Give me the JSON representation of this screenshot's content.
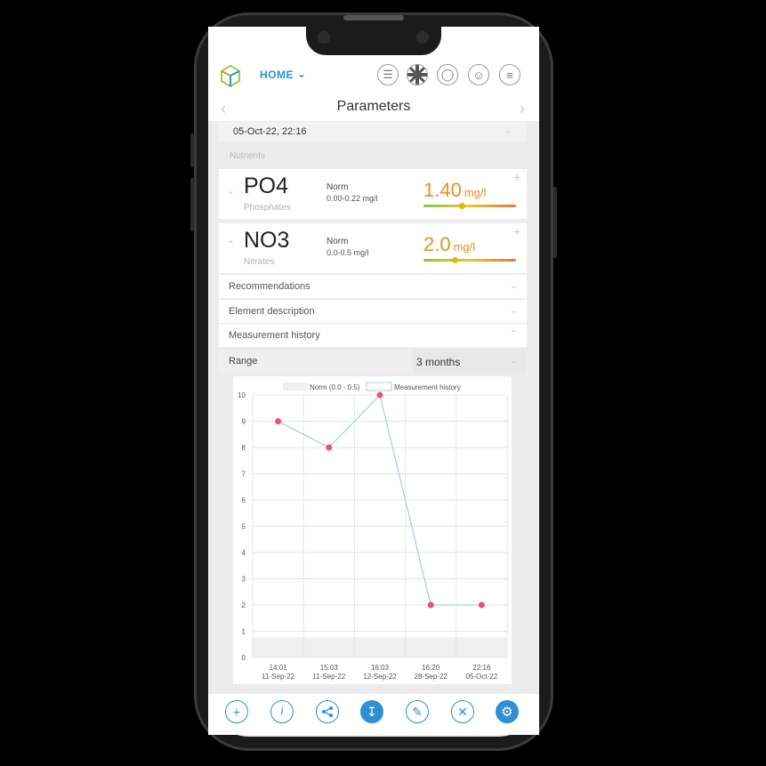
{
  "header": {
    "home_label": "HOME",
    "icons": [
      "chat-icon",
      "language-flag-icon",
      "globe-icon",
      "user-icon",
      "menu-icon"
    ]
  },
  "page": {
    "title": "Parameters",
    "datetime": "05-Oct-22, 22:16",
    "section_label": "Nutrients"
  },
  "parameters": [
    {
      "symbol": "PO4",
      "name": "Phosphates",
      "norm_label": "Norm",
      "norm_range": "0.00-0.22 mg/l",
      "value": "1.40",
      "unit": "mg/l",
      "gauge_level": 0.42
    },
    {
      "symbol": "NO3",
      "name": "Nitrates",
      "norm_label": "Norm",
      "norm_range": "0.0-0.5 mg/l",
      "value": "2.0",
      "unit": "mg/l",
      "gauge_level": 0.34
    }
  ],
  "accordions": {
    "recommendations": "Recommendations",
    "element_description": "Element description",
    "measurement_history": "Measurement history"
  },
  "range": {
    "label": "Range",
    "value": "3 months"
  },
  "chart_data": {
    "type": "line",
    "legend": [
      "Norm (0.0 - 0.5)",
      "Measurement history"
    ],
    "x": [
      "14:01 11-Sep-22",
      "15:03 11-Sep-22",
      "16:03 12-Sep-22",
      "16:20 28-Sep-22",
      "22:16 05-Oct-22"
    ],
    "x_time": [
      "14:01",
      "15:03",
      "16:03",
      "16:20",
      "22:16"
    ],
    "x_date": [
      "11-Sep-22",
      "11-Sep-22",
      "12-Sep-22",
      "28-Sep-22",
      "05-Oct-22"
    ],
    "series": [
      {
        "name": "Measurement history",
        "values": [
          9,
          8,
          10,
          2,
          2
        ]
      }
    ],
    "norm_band": [
      0.0,
      0.5
    ],
    "ylim": [
      0,
      10
    ],
    "yticks": [
      0,
      1,
      2,
      3,
      4,
      5,
      6,
      7,
      8,
      9,
      10
    ],
    "grid": true,
    "legend_position": "top",
    "colors": {
      "line": "#a9cfe8",
      "point": "#f0506e",
      "norm": "#f0f0f0"
    }
  },
  "footer": {
    "icons": [
      "add-icon",
      "info-icon",
      "share-icon",
      "download-icon",
      "edit-icon",
      "close-icon",
      "settings-icon"
    ]
  }
}
